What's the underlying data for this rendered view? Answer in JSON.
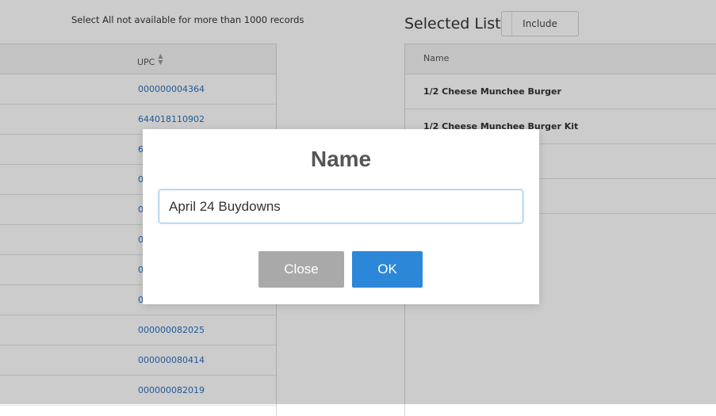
{
  "notice": "Select All not available for more than 1000 records",
  "left_table": {
    "header_upc": "UPC",
    "rows": [
      {
        "upc": "000000004364"
      },
      {
        "upc": "644018110902"
      },
      {
        "upc": "6"
      },
      {
        "upc": "0"
      },
      {
        "upc": "0"
      },
      {
        "upc": "0"
      },
      {
        "upc": "0"
      },
      {
        "upc": "0"
      },
      {
        "upc": "000000082025"
      },
      {
        "upc": "000000080414"
      },
      {
        "upc": "000000082019"
      }
    ]
  },
  "selected_list": {
    "title": "Selected List",
    "include_label": "Include",
    "header_name": "Name",
    "rows": [
      {
        "name": "1/2 Cheese Munchee Burger"
      },
      {
        "name": "1/2 Cheese Munchee Burger Kit"
      }
    ]
  },
  "modal": {
    "title": "Name",
    "input_value": "April 24 Buydowns",
    "close_label": "Close",
    "ok_label": "OK"
  }
}
